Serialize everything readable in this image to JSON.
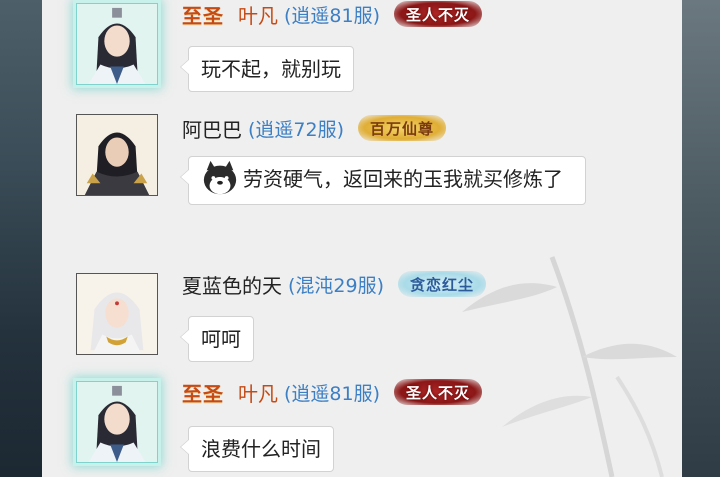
{
  "messages": [
    {
      "rank": "至圣",
      "name": "叶凡",
      "server": "(逍遥81服)",
      "badge": "圣人不灭",
      "badge_style": "red",
      "text": "玩不起，就别玩"
    },
    {
      "rank": "",
      "name": "阿巴巴",
      "server": "(逍遥72服)",
      "badge": "百万仙尊",
      "badge_style": "gold",
      "text": "劳资硬气，返回来的玉我就买修炼了",
      "emoji": "dog-emoji"
    },
    {
      "rank": "",
      "name": "夏蓝色的天",
      "server": "(混沌29服)",
      "badge": "贪恋红尘",
      "badge_style": "teal",
      "text": "呵呵"
    },
    {
      "rank": "至圣",
      "name": "叶凡",
      "server": "(逍遥81服)",
      "badge": "圣人不灭",
      "badge_style": "red",
      "text": "浪费什么时间"
    }
  ],
  "colors": {
    "panel_bg": "#efefef",
    "rank_text": "#c54a14",
    "server_text": "#3c7fc4",
    "bubble_bg": "#ffffff"
  }
}
